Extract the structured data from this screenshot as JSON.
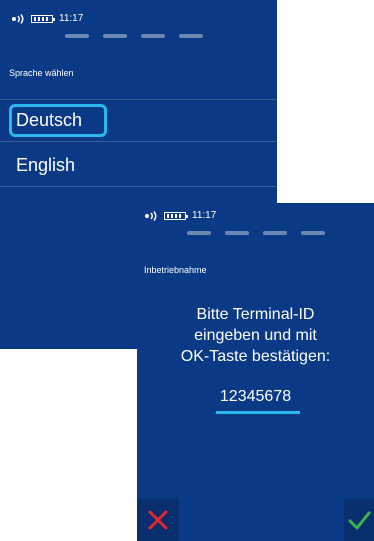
{
  "screen_language": {
    "status": {
      "time": "11:17"
    },
    "breadcrumb": "Sprache wählen",
    "languages": [
      {
        "label": "Deutsch",
        "selected": true
      },
      {
        "label": "English",
        "selected": false
      }
    ]
  },
  "screen_terminal": {
    "status": {
      "time": "11:17"
    },
    "breadcrumb": "Inbetriebnahme",
    "prompt_lines": [
      "Bitte Terminal-ID",
      "eingeben und mit",
      "OK-Taste bestätigen:"
    ],
    "terminal_id": "12345678",
    "cancel_icon": "cross-icon",
    "ok_icon": "checkmark-icon"
  },
  "colors": {
    "background": "#0a3a85",
    "accent": "#2cb7f0",
    "cancel": "#e5252c",
    "ok": "#39b54a"
  }
}
